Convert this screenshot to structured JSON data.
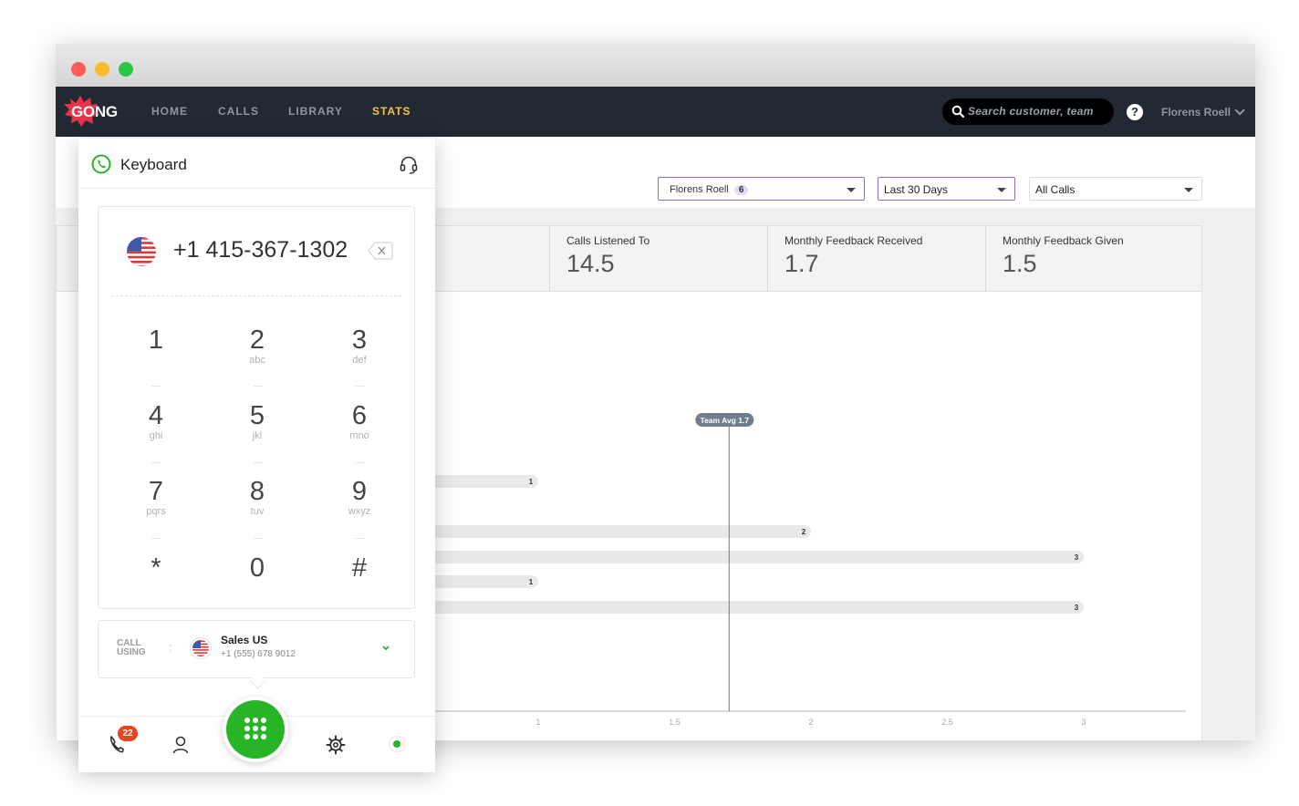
{
  "window": {
    "controls": [
      "close",
      "minimize",
      "maximize"
    ]
  },
  "app": {
    "logo_text": "GONG",
    "nav": [
      {
        "label": "HOME",
        "active": false
      },
      {
        "label": "CALLS",
        "active": false
      },
      {
        "label": "LIBRARY",
        "active": false
      },
      {
        "label": "STATS",
        "active": true
      }
    ],
    "search_placeholder": "Search customer, team",
    "help_label": "?",
    "user_name": "Florens Roell"
  },
  "filters": {
    "person": {
      "label": "Florens Roell",
      "count": "6"
    },
    "period": "Last 30 Days",
    "calls": "All Calls"
  },
  "stats": [
    {
      "label": "Calls Listened To",
      "value": "14.5"
    },
    {
      "label": "Monthly Feedback Received",
      "value": "1.7"
    },
    {
      "label": "Monthly Feedback Given",
      "value": "1.5"
    }
  ],
  "chart_data": {
    "type": "bar",
    "orientation": "horizontal",
    "title": "",
    "xlabel": "",
    "ylabel": "",
    "values": [
      1,
      2,
      3,
      1,
      3
    ],
    "x_ticks": [
      "1",
      "1.5",
      "2",
      "2.5",
      "3"
    ],
    "reference_line": {
      "label": "Team Avg 1.7",
      "value": 1.7
    },
    "grid": false
  },
  "dialer": {
    "title": "Keyboard",
    "phone_number": "+1 415-367-1302",
    "keys": [
      {
        "digit": "1",
        "letters": ""
      },
      {
        "digit": "2",
        "letters": "abc"
      },
      {
        "digit": "3",
        "letters": "def"
      },
      {
        "digit": "4",
        "letters": "ghi"
      },
      {
        "digit": "5",
        "letters": "jkl"
      },
      {
        "digit": "6",
        "letters": "mno"
      },
      {
        "digit": "7",
        "letters": "pqrs"
      },
      {
        "digit": "8",
        "letters": "tuv"
      },
      {
        "digit": "9",
        "letters": "wxyz"
      },
      {
        "digit": "*",
        "letters": ""
      },
      {
        "digit": "0",
        "letters": ""
      },
      {
        "digit": "#",
        "letters": ""
      }
    ],
    "call_using": {
      "label_line1": "CALL",
      "label_line2": "USING",
      "separator": ":",
      "name": "Sales US",
      "number": "+1 (555) 678 9012"
    },
    "missed_calls_badge": "22",
    "status": "online",
    "colors": {
      "accent_green": "#27b527",
      "badge_red": "#e8441e",
      "nav_bg": "#232932",
      "active_nav": "#f6c445"
    }
  }
}
